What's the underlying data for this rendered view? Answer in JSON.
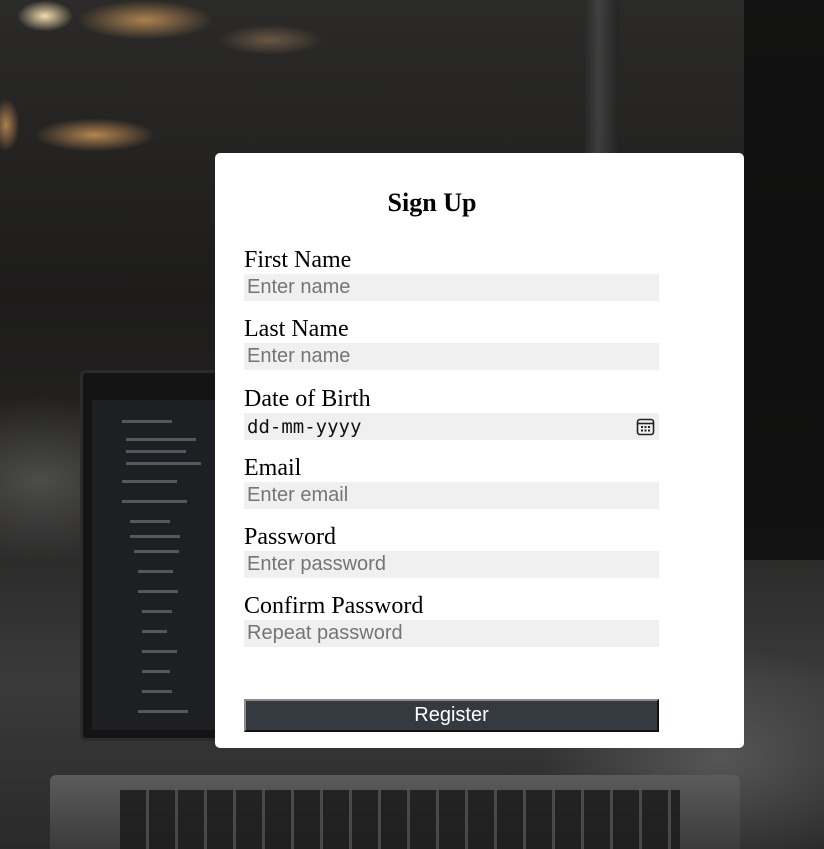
{
  "form": {
    "title": "Sign Up",
    "fields": {
      "first_name": {
        "label": "First Name",
        "placeholder": "Enter name",
        "value": ""
      },
      "last_name": {
        "label": "Last Name",
        "placeholder": "Enter name",
        "value": ""
      },
      "dob": {
        "label": "Date of Birth",
        "placeholder": "dd-mm-yyyy",
        "icon": "calendar-icon"
      },
      "email": {
        "label": "Email",
        "placeholder": "Enter email",
        "value": ""
      },
      "password": {
        "label": "Password",
        "placeholder": "Enter password",
        "value": ""
      },
      "confirm_password": {
        "label": "Confirm Password",
        "placeholder": "Repeat password",
        "value": ""
      }
    },
    "submit_label": "Register"
  },
  "colors": {
    "card_background": "#ffffff",
    "input_background": "#f0f0f0",
    "button_background": "#343a40",
    "button_text": "#ffffff"
  }
}
